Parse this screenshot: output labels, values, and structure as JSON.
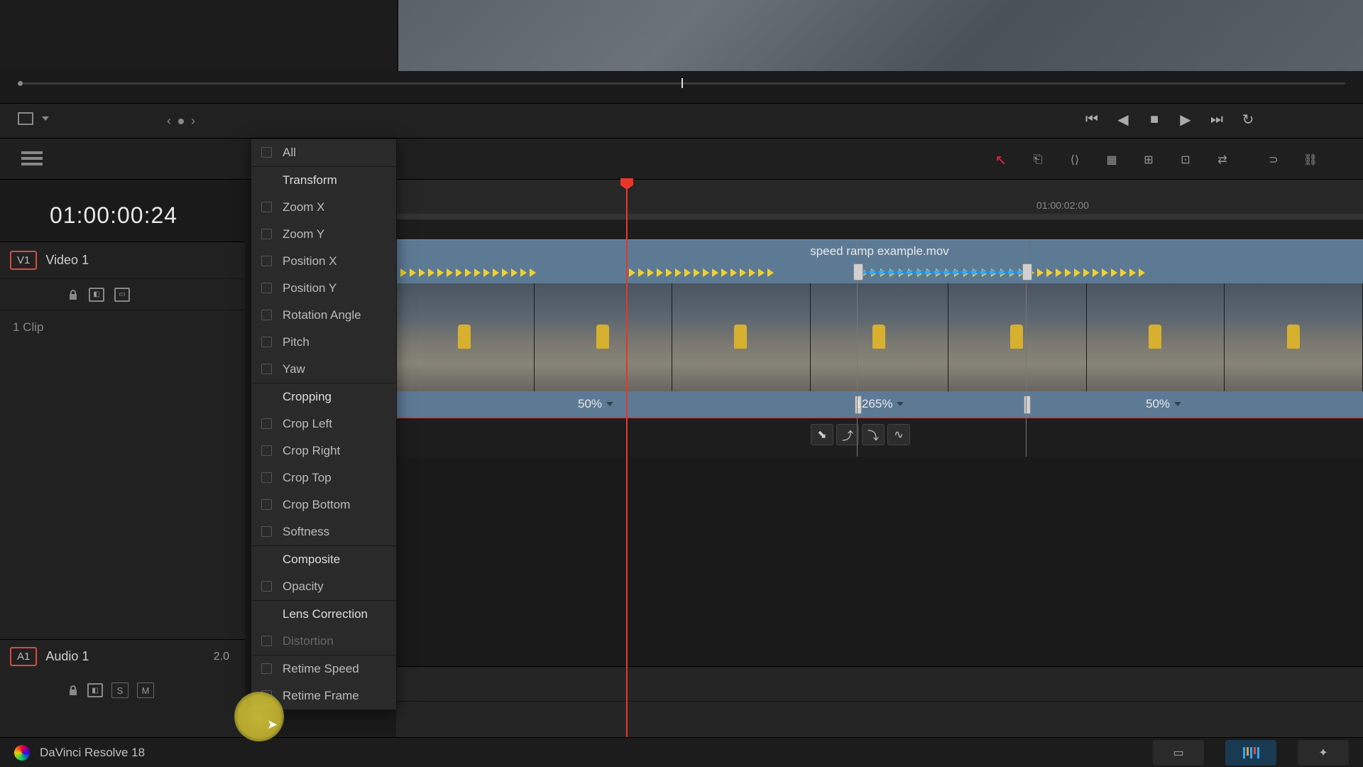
{
  "app": {
    "name": "DaVinci Resolve 18"
  },
  "timecode": "01:00:00:24",
  "ruler": {
    "label1": "01:00:02:00"
  },
  "tracks": {
    "video": {
      "badge": "V1",
      "name": "Video 1",
      "clip_count": "1 Clip"
    },
    "audio": {
      "badge": "A1",
      "name": "Audio 1",
      "value": "2.0",
      "solo": "S",
      "mute": "M"
    }
  },
  "clip": {
    "title": "speed ramp example.mov",
    "speeds": [
      "50%",
      "1265%",
      "50%"
    ]
  },
  "curve_menu": {
    "all": "All",
    "transform": "Transform",
    "zoom_x": "Zoom X",
    "zoom_y": "Zoom Y",
    "position_x": "Position X",
    "position_y": "Position Y",
    "rotation": "Rotation Angle",
    "pitch": "Pitch",
    "yaw": "Yaw",
    "cropping": "Cropping",
    "crop_left": "Crop Left",
    "crop_right": "Crop Right",
    "crop_top": "Crop Top",
    "crop_bottom": "Crop Bottom",
    "softness": "Softness",
    "composite": "Composite",
    "opacity": "Opacity",
    "lens": "Lens Correction",
    "distortion": "Distortion",
    "retime_speed": "Retime Speed",
    "retime_frame": "Retime Frame"
  }
}
